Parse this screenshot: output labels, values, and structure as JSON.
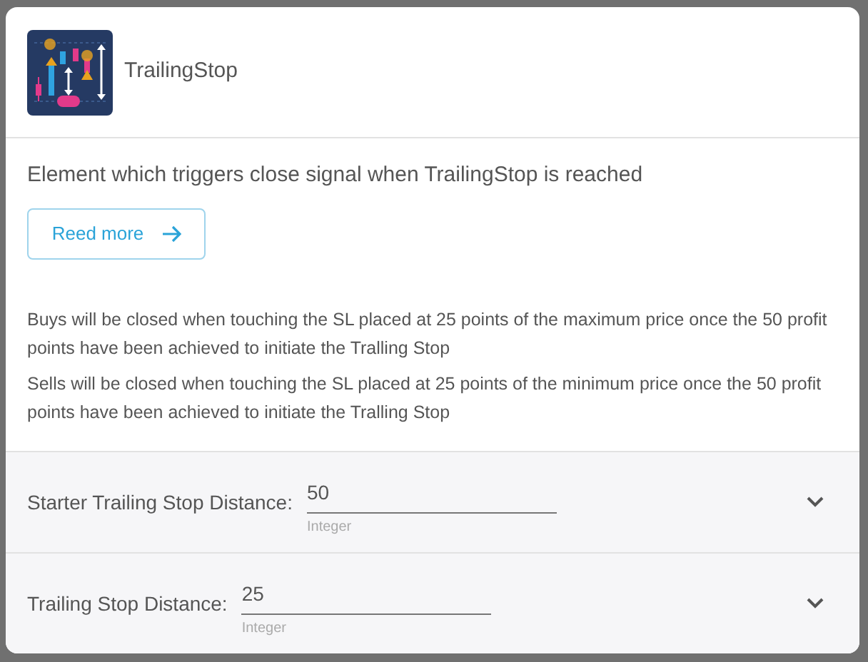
{
  "header": {
    "title": "TrailingStop"
  },
  "description": "Element which triggers close signal when TrailingStop is reached",
  "read_more": {
    "label": "Reed more"
  },
  "notes": [
    "Buys will be closed when touching the SL placed at 25 points of the maximum price once the 50 profit points have been achieved to initiate the Tralling Stop",
    "Sells will be closed when touching the SL placed at 25 points of the minimum price once the 50 profit points have been achieved to initiate the Tralling Stop"
  ],
  "parameters": [
    {
      "label": "Starter Trailing Stop Distance:",
      "value": "50",
      "hint": "Integer",
      "expanded": false
    },
    {
      "label": "Trailing Stop Distance:",
      "value": "25",
      "hint": "Integer",
      "expanded": false
    }
  ]
}
